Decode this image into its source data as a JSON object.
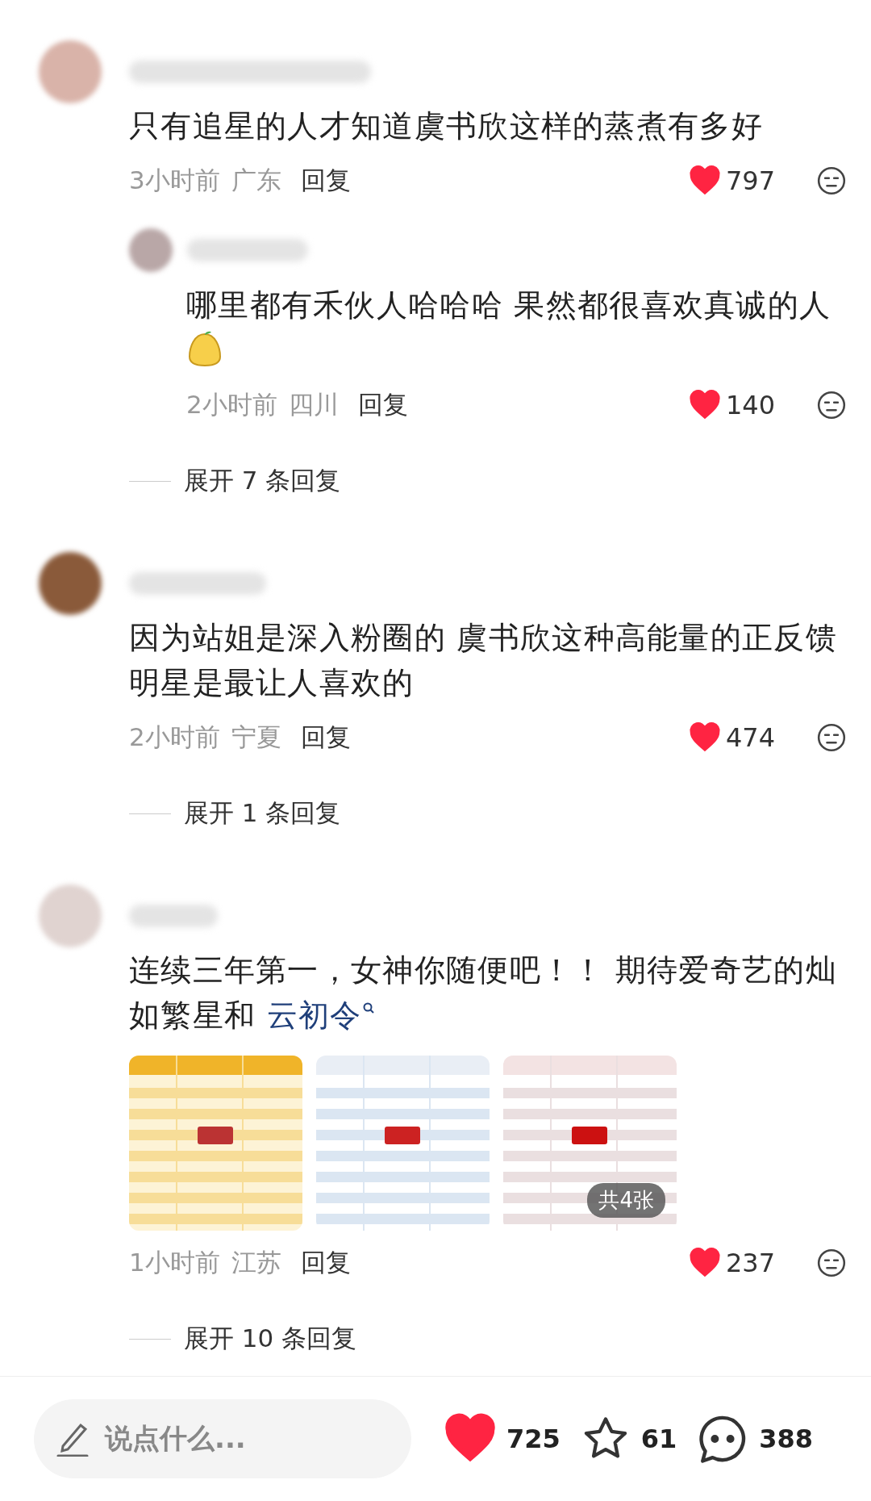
{
  "comments": [
    {
      "text": "只有追星的人才知道虞书欣这样的蒸煮有多好",
      "time": "3小时前",
      "location": "广东",
      "reply_label": "回复",
      "likes": "797",
      "liked": true,
      "replies": [
        {
          "text": "哪里都有禾伙人哈哈哈 果然都很喜欢真诚的人",
          "has_sticker": true,
          "time": "2小时前",
          "location": "四川",
          "reply_label": "回复",
          "likes": "140",
          "liked": true
        }
      ],
      "expand": "展开 7 条回复"
    },
    {
      "text": "因为站姐是深入粉圈的 虞书欣这种高能量的正反馈明星是最让人喜欢的",
      "time": "2小时前",
      "location": "宁夏",
      "reply_label": "回复",
      "likes": "474",
      "liked": true,
      "expand": "展开 1 条回复"
    },
    {
      "text": "连续三年第一，女神你随便吧！！ 期待爱奇艺的灿如繁星和 ",
      "link": "云初令",
      "image_count_badge": "共4张",
      "time": "1小时前",
      "location": "江苏",
      "reply_label": "回复",
      "likes": "237",
      "liked": true,
      "expand": "展开 10 条回复"
    }
  ],
  "bottom_bar": {
    "placeholder": "说点什么...",
    "likes": "725",
    "liked": true,
    "favorites": "61",
    "favorited": false,
    "comments": "388"
  }
}
